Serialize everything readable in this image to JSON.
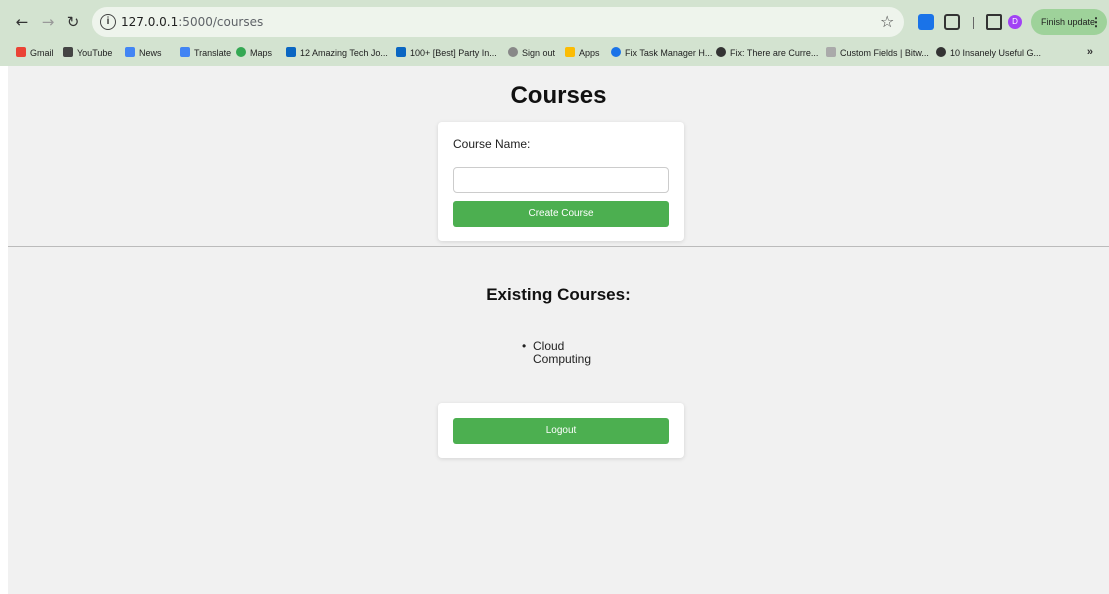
{
  "browser": {
    "url_host": "127.0.0.1",
    "url_path": ":5000/courses",
    "update_label": "Finish update",
    "avatar_initial": "D",
    "bookmarks": [
      {
        "label": "Gmail",
        "color": "#ea4335"
      },
      {
        "label": "YouTube",
        "color": "#444444"
      },
      {
        "label": "News",
        "color": "#4285f4"
      },
      {
        "label": "Translate",
        "color": "#4285f4"
      },
      {
        "label": "Maps",
        "color": "#34a853"
      },
      {
        "label": "12 Amazing Tech Jo...",
        "color": "#0a66c2"
      },
      {
        "label": "100+ [Best] Party In...",
        "color": "#0a66c2"
      },
      {
        "label": "Sign out",
        "color": "#888888"
      },
      {
        "label": "Apps",
        "color": "#fbbc04"
      },
      {
        "label": "Fix Task Manager H...",
        "color": "#1a73e8"
      },
      {
        "label": "Fix: There are Curre...",
        "color": "#333333"
      },
      {
        "label": "Custom Fields | Bitw...",
        "color": "#aaaaaa"
      },
      {
        "label": "10 Insanely Useful G...",
        "color": "#333333"
      }
    ],
    "more_label": "»"
  },
  "page": {
    "title": "Courses",
    "form": {
      "label": "Course Name:",
      "input_value": "",
      "submit_label": "Create Course"
    },
    "existing_heading": "Existing Courses:",
    "courses": [
      "Cloud Computing"
    ],
    "logout_label": "Logout"
  },
  "colors": {
    "accent": "#4caf50",
    "chrome": "#d3e3d0",
    "page_bg": "#f1f1f1"
  }
}
